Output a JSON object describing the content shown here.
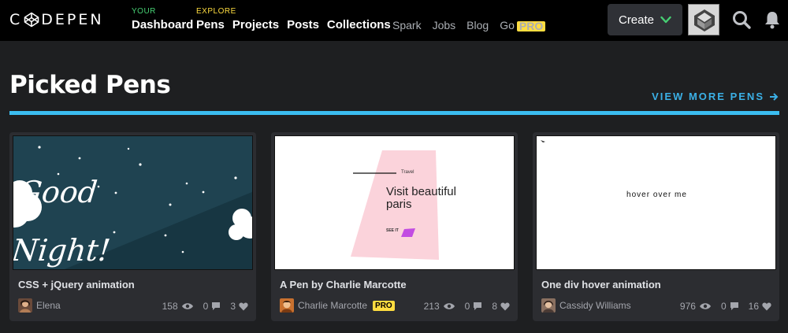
{
  "brand": {
    "logo_text_left": "C",
    "logo_text_right": "DEPEN"
  },
  "nav": {
    "your_kicker": "YOUR",
    "your_items": [
      "Dashboard"
    ],
    "explore_kicker": "EXPLORE",
    "explore_items": [
      "Pens",
      "Projects",
      "Posts",
      "Collections"
    ],
    "plain_items": [
      "Spark",
      "Jobs",
      "Blog",
      "Go"
    ],
    "go_badge": "PRO"
  },
  "header": {
    "create_label": "Create"
  },
  "section": {
    "title": "Picked Pens",
    "view_more": "VIEW MORE PENS"
  },
  "cards": [
    {
      "title": "CSS + jQuery animation",
      "author": "Elena",
      "pro": "",
      "views": "158",
      "comments": "0",
      "hearts": "3",
      "preview_text": "Good Night!"
    },
    {
      "title": "A Pen by Charlie Marcotte",
      "author": "Charlie Marcotte",
      "pro": "PRO",
      "views": "213",
      "comments": "0",
      "hearts": "8",
      "preview_kicker": "Travel",
      "preview_heading_1": "Visit beautiful",
      "preview_heading_2": "paris",
      "preview_cta": "SEE IT"
    },
    {
      "title": "One div hover animation",
      "author": "Cassidy Williams",
      "pro": "",
      "views": "976",
      "comments": "0",
      "hearts": "16",
      "preview_text": "hover over me"
    }
  ],
  "colors": {
    "accent_blue": "#3bbdf0",
    "create_check": "#47cf73",
    "pro_yellow": "#ffdd40"
  }
}
